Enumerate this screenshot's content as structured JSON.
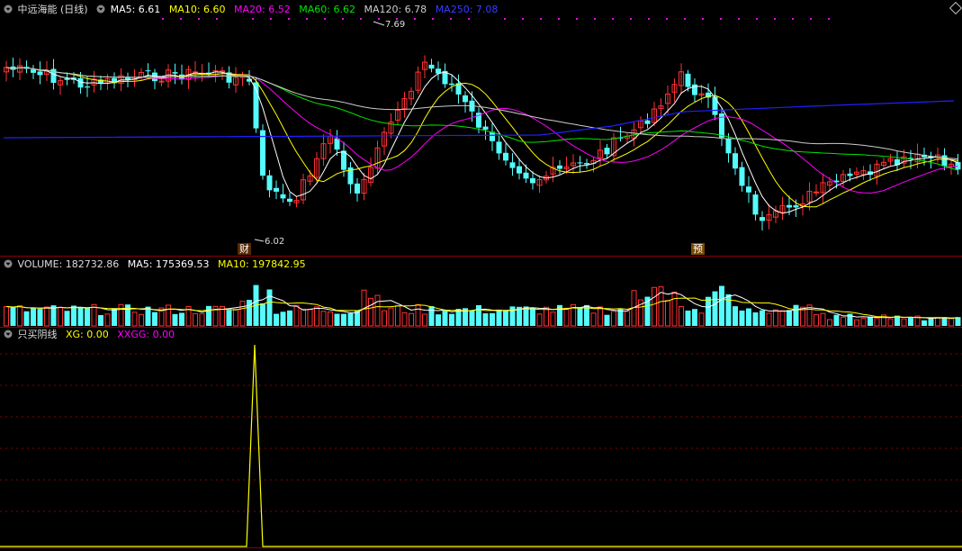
{
  "price_panel": {
    "title": "中远海能 (日线)",
    "ma5": "MA5: 6.61",
    "ma10": "MA10: 6.60",
    "ma20": "MA20: 6.52",
    "ma60": "MA60: 6.62",
    "ma120": "MA120: 6.78",
    "ma250": "MA250: 7.08",
    "high_label": "7.69",
    "low_label": "6.02",
    "badge_cai": "财",
    "badge_yu": "预"
  },
  "volume_panel": {
    "title": "VOLUME: 182732.86",
    "ma5": "MA5: 175369.53",
    "ma10": "MA10: 197842.95"
  },
  "indicator_panel": {
    "title": "只买阴线",
    "xg": "XG: 0.00",
    "xxgg": "XXGG: 0.00"
  },
  "colors": {
    "up": "#ff3232",
    "down": "#54fcfc",
    "ma5": "#ffffff",
    "ma10": "#ffff00",
    "ma20": "#ff00ff",
    "ma60": "#00e600",
    "ma120": "#cccccc",
    "ma250": "#2020ff",
    "grid": "#8b0000",
    "xg_line": "#ffff00"
  }
}
